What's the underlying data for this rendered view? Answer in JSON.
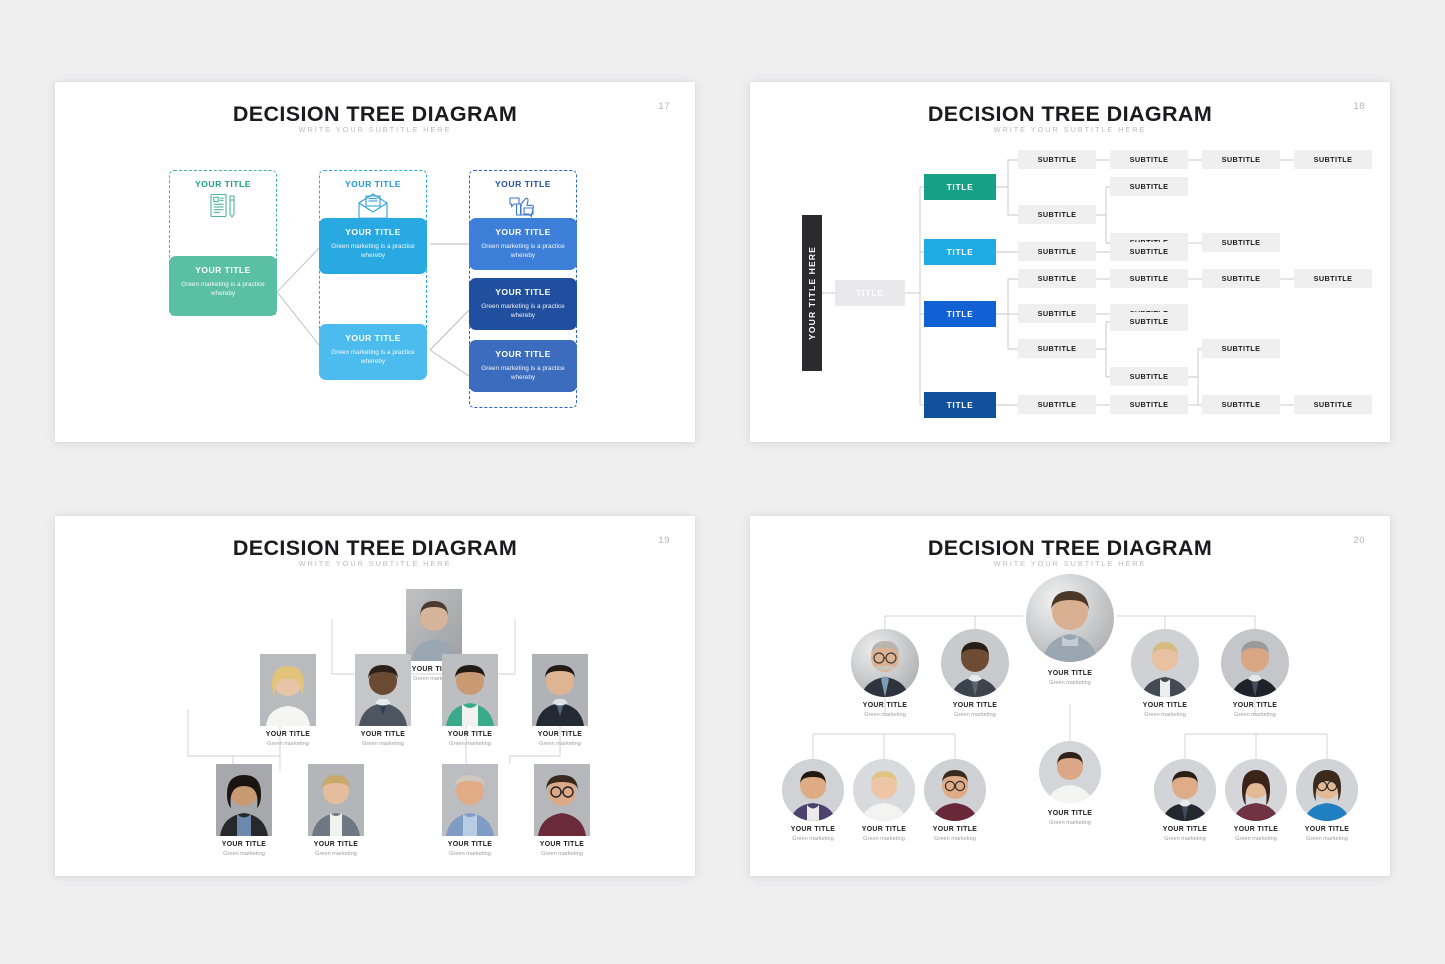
{
  "deck": {
    "background": "#efeff0",
    "slide_title": "DECISION TREE DIAGRAM",
    "slide_subtitle": "WRITE YOUR SUBTITLE HERE"
  },
  "slide1": {
    "page_number": "17",
    "title": "DECISION TREE DIAGRAM",
    "subtitle": "WRITE YOUR SUBTITLE HERE",
    "columns": [
      {
        "head": "YOUR TITLE",
        "color": "#3cb79a",
        "icon": "document-pen-icon"
      },
      {
        "head": "YOUR TITLE",
        "color": "#2aaae2",
        "icon": "open-envelope-icon"
      },
      {
        "head": "YOUR TITLE",
        "color": "#2c63c4",
        "icon": "thumbs-up-chat-icon"
      }
    ],
    "cards": [
      {
        "title": "YOUR TITLE",
        "desc": "Green marketing is a practice whereby",
        "color": "#5bbfa4"
      },
      {
        "title": "YOUR TITLE",
        "desc": "Green marketing is a practice whereby",
        "color": "#29a9e1"
      },
      {
        "title": "YOUR TITLE",
        "desc": "Green marketing is a practice whereby",
        "color": "#4cbcee"
      },
      {
        "title": "YOUR TITLE",
        "desc": "Green marketing is a practice whereby",
        "color": "#3d7fd8"
      },
      {
        "title": "YOUR TITLE",
        "desc": "Green marketing is a practice whereby",
        "color": "#1f4f9e"
      },
      {
        "title": "YOUR TITLE",
        "desc": "Green marketing is a practice whereby",
        "color": "#3b6cbd"
      }
    ]
  },
  "slide2": {
    "page_number": "18",
    "title": "DECISION TREE DIAGRAM",
    "subtitle": "WRITE YOUR SUBTITLE HERE",
    "vertical_title": "YOUR TITLE HERE",
    "root_label": "TITLE",
    "root_color": "#e9e9eb",
    "branches": [
      {
        "label": "TITLE",
        "color": "#16a085"
      },
      {
        "label": "TITLE",
        "color": "#1fabe3"
      },
      {
        "label": "TITLE",
        "color": "#1160d4"
      },
      {
        "label": "TITLE",
        "color": "#12509e"
      }
    ],
    "subtitle_label": "SUBTITLE",
    "subtitle_box_color": "#efeff0",
    "subtitles": [
      {
        "row": 1,
        "col": 1
      },
      {
        "row": 1,
        "col": 2
      },
      {
        "row": 1,
        "col": 3
      },
      {
        "row": 1,
        "col": 4
      },
      {
        "row": 2,
        "col": 1
      },
      {
        "row": 2,
        "col": 2
      },
      {
        "row": 3,
        "col": 2
      },
      {
        "row": 3,
        "col": 3
      },
      {
        "row": 4,
        "col": 1
      },
      {
        "row": 4,
        "col": 2
      },
      {
        "row": 5,
        "col": 1
      },
      {
        "row": 5,
        "col": 2
      },
      {
        "row": 5,
        "col": 3
      },
      {
        "row": 5,
        "col": 4
      },
      {
        "row": 6,
        "col": 1
      },
      {
        "row": 6,
        "col": 2
      },
      {
        "row": 7,
        "col": 2
      },
      {
        "row": 8,
        "col": 1
      },
      {
        "row": 8,
        "col": 2
      },
      {
        "row": 8,
        "col": 3
      },
      {
        "row": 9,
        "col": 3
      },
      {
        "row": 10,
        "col": 1
      },
      {
        "row": 10,
        "col": 2
      },
      {
        "row": 10,
        "col": 3
      },
      {
        "row": 10,
        "col": 4
      }
    ]
  },
  "slide3": {
    "page_number": "19",
    "title": "DECISION TREE DIAGRAM",
    "subtitle": "WRITE YOUR SUBTITLE HERE",
    "people": [
      {
        "name": "YOUR TITLE",
        "role": "Green marketing",
        "level": 1,
        "photo": "portrait-man-gray-shirt"
      },
      {
        "name": "YOUR TITLE",
        "role": "Green marketing",
        "level": 2,
        "photo": "portrait-blonde-woman-white-top"
      },
      {
        "name": "YOUR TITLE",
        "role": "Green marketing",
        "level": 2,
        "photo": "portrait-man-suit-blue-tie"
      },
      {
        "name": "YOUR TITLE",
        "role": "Green marketing",
        "level": 2,
        "photo": "portrait-woman-green-cardigan"
      },
      {
        "name": "YOUR TITLE",
        "role": "Green marketing",
        "level": 2,
        "photo": "portrait-man-dark-suit"
      },
      {
        "name": "YOUR TITLE",
        "role": "Green marketing",
        "level": 3,
        "photo": "portrait-dark-hair-woman-blazer"
      },
      {
        "name": "YOUR TITLE",
        "role": "Green marketing",
        "level": 3,
        "photo": "portrait-blonde-woman-gray-suit"
      },
      {
        "name": "YOUR TITLE",
        "role": "Green marketing",
        "level": 3,
        "photo": "portrait-older-man-blue-shirt"
      },
      {
        "name": "YOUR TITLE",
        "role": "Green marketing",
        "level": 3,
        "photo": "portrait-man-glasses-maroon"
      }
    ]
  },
  "slide4": {
    "page_number": "20",
    "title": "DECISION TREE DIAGRAM",
    "subtitle": "WRITE YOUR SUBTITLE HERE",
    "people": [
      {
        "name": "YOUR TITLE",
        "role": "Green marketing",
        "level": 1,
        "photo": "portrait-man-gray-shirt"
      },
      {
        "name": "YOUR TITLE",
        "role": "Green marketing",
        "level": 2,
        "photo": "portrait-older-man-glasses-mustache"
      },
      {
        "name": "YOUR TITLE",
        "role": "Green marketing",
        "level": 2,
        "photo": "portrait-man-suit-gray-tie"
      },
      {
        "name": "YOUR TITLE",
        "role": "Green marketing",
        "level": 2,
        "photo": "portrait-blonde-woman-suit"
      },
      {
        "name": "YOUR TITLE",
        "role": "Green marketing",
        "level": 2,
        "photo": "portrait-silver-hair-man-suit"
      },
      {
        "name": "YOUR TITLE",
        "role": "Green marketing",
        "level": 3,
        "photo": "portrait-young-man-purple-vneck"
      },
      {
        "name": "YOUR TITLE",
        "role": "Green marketing",
        "level": 3,
        "photo": "portrait-short-hair-blonde-woman"
      },
      {
        "name": "YOUR TITLE",
        "role": "Green marketing",
        "level": 3,
        "photo": "portrait-man-glasses-maroon"
      },
      {
        "name": "YOUR TITLE",
        "role": "Green marketing",
        "level": 3,
        "photo": "portrait-man-white-tshirt"
      },
      {
        "name": "YOUR TITLE",
        "role": "Green marketing",
        "level": 3,
        "photo": "portrait-man-suit-smiling"
      },
      {
        "name": "YOUR TITLE",
        "role": "Green marketing",
        "level": 3,
        "photo": "portrait-brunette-woman-long-hair"
      },
      {
        "name": "YOUR TITLE",
        "role": "Green marketing",
        "level": 3,
        "photo": "portrait-woman-glasses-blue-top"
      }
    ]
  }
}
